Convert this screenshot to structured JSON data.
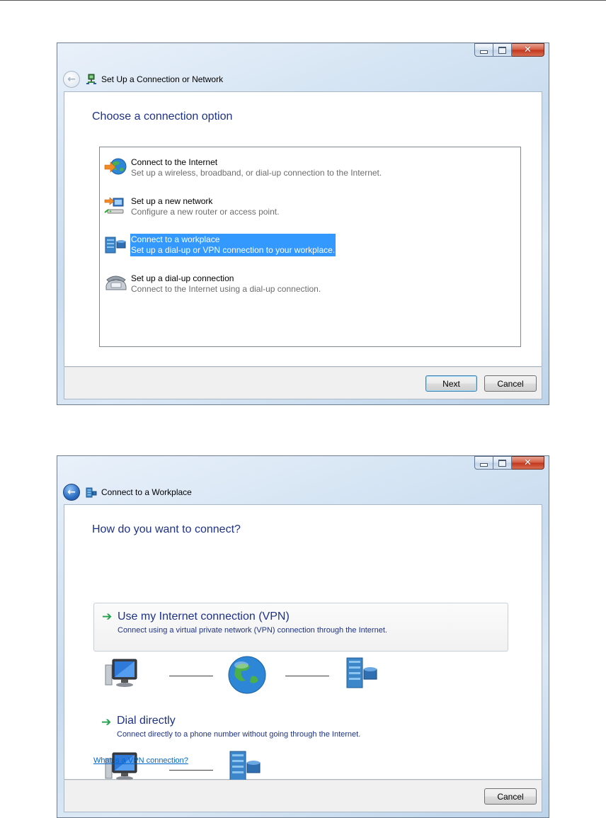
{
  "window1": {
    "title": "Set Up a Connection or Network",
    "heading": "Choose a connection option",
    "options": [
      {
        "title": "Connect to the Internet",
        "desc": "Set up a wireless, broadband, or dial-up connection to the Internet.",
        "icon": "internet-globe-icon",
        "selected": false
      },
      {
        "title": "Set up a new network",
        "desc": "Configure a new router or access point.",
        "icon": "network-router-icon",
        "selected": false
      },
      {
        "title": "Connect to a workplace",
        "desc": "Set up a dial-up or VPN connection to your workplace.",
        "icon": "workplace-building-icon",
        "selected": true
      },
      {
        "title": "Set up a dial-up connection",
        "desc": "Connect to the Internet using a dial-up connection.",
        "icon": "phone-modem-icon",
        "selected": false
      }
    ],
    "next_label": "Next",
    "cancel_label": "Cancel"
  },
  "window2": {
    "title": "Connect to a Workplace",
    "heading": "How do you want to connect?",
    "vpn": {
      "title": "Use my Internet connection (VPN)",
      "desc": "Connect using a virtual private network (VPN) connection through the Internet."
    },
    "dial": {
      "title": "Dial directly",
      "desc": "Connect directly to a phone number without going through the Internet."
    },
    "help_link": "What is a VPN connection?",
    "cancel_label": "Cancel"
  },
  "caption_buttons": {
    "minimize": "minimize-icon",
    "maximize": "maximize-icon",
    "close": "close-icon"
  },
  "colors": {
    "heading": "#1e3287",
    "selection": "#3399ff",
    "link": "#0066cc",
    "arrow": "#23a04b"
  }
}
